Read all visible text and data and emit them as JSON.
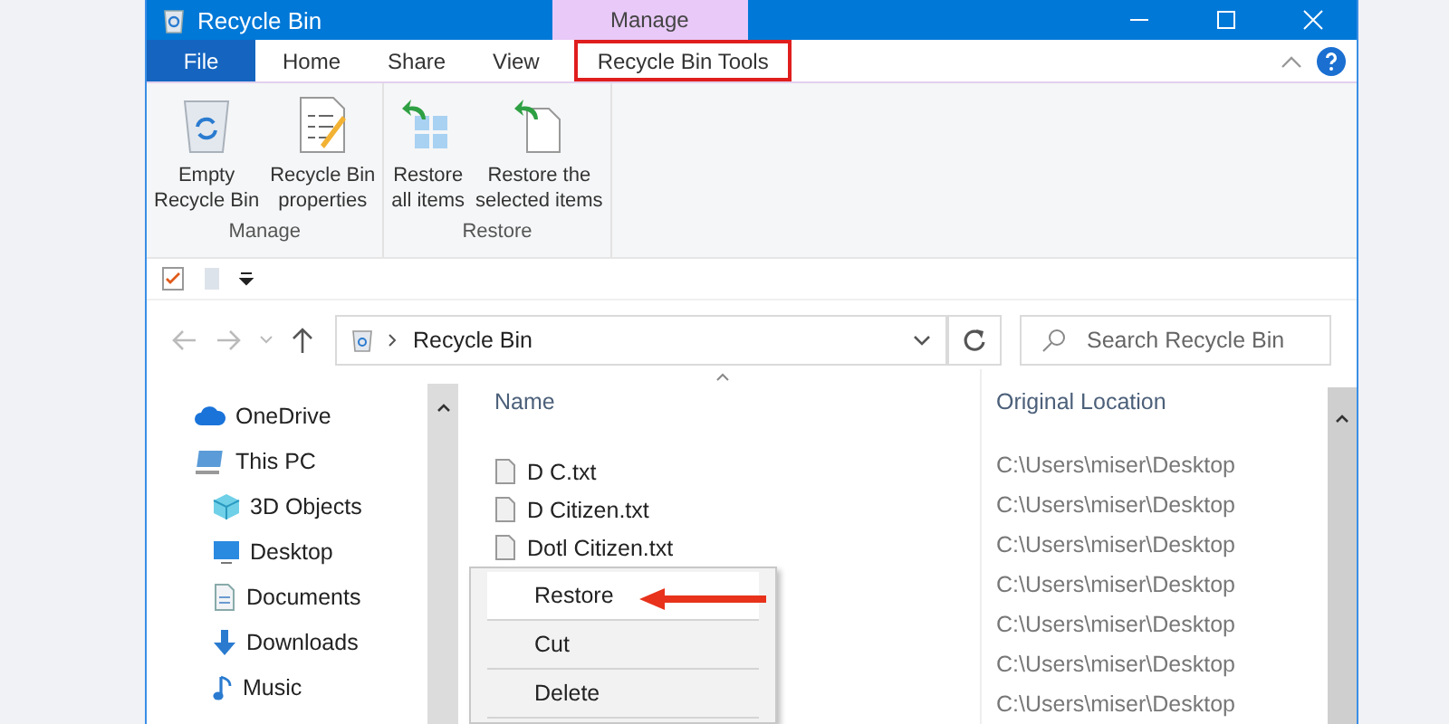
{
  "window": {
    "title": "Recycle Bin",
    "context_header": "Manage"
  },
  "tabs": [
    {
      "label": "File",
      "kind": "file",
      "selected": false,
      "highlighted": false
    },
    {
      "label": "Home",
      "kind": "tab",
      "selected": false,
      "highlighted": false
    },
    {
      "label": "Share",
      "kind": "tab",
      "selected": false,
      "highlighted": false
    },
    {
      "label": "View",
      "kind": "tab",
      "selected": false,
      "highlighted": false
    },
    {
      "label": "Recycle Bin Tools",
      "kind": "tab",
      "selected": true,
      "highlighted": true
    }
  ],
  "ribbon_groups": [
    {
      "label": "Manage",
      "buttons": [
        {
          "kind": "bin",
          "lines": [
            "Empty",
            "Recycle Bin"
          ]
        },
        {
          "kind": "properties",
          "lines": [
            "Recycle Bin",
            "properties"
          ]
        }
      ]
    },
    {
      "label": "Restore",
      "buttons": [
        {
          "kind": "restore-all",
          "lines": [
            "Restore",
            "all items"
          ]
        },
        {
          "kind": "restore-selected",
          "lines": [
            "Restore the",
            "selected items"
          ]
        }
      ]
    }
  ],
  "address": {
    "path": "Recycle Bin"
  },
  "search": {
    "placeholder": "Search Recycle Bin"
  },
  "nav": [
    {
      "label": "OneDrive",
      "kind": "cloud"
    },
    {
      "label": "This PC",
      "kind": "pc",
      "children": [
        {
          "label": "3D Objects",
          "kind": "cube"
        },
        {
          "label": "Desktop",
          "kind": "desktop"
        },
        {
          "label": "Documents",
          "kind": "document"
        },
        {
          "label": "Downloads",
          "kind": "download"
        },
        {
          "label": "Music",
          "kind": "music"
        }
      ]
    }
  ],
  "columns": [
    "Name",
    "Original Location"
  ],
  "names": [
    "D C.txt",
    "D Citizen.txt",
    "Dotl Citizen.txt"
  ],
  "locations": [
    "C:\\Users\\miser\\Desktop",
    "C:\\Users\\miser\\Desktop",
    "C:\\Users\\miser\\Desktop",
    "C:\\Users\\miser\\Desktop",
    "C:\\Users\\miser\\Desktop",
    "C:\\Users\\miser\\Desktop",
    "C:\\Users\\miser\\Desktop"
  ],
  "context_menu": [
    {
      "label": "Restore",
      "pointed": true
    },
    {
      "label": "Cut",
      "pointed": false
    },
    {
      "label": "Delete",
      "pointed": false
    }
  ]
}
